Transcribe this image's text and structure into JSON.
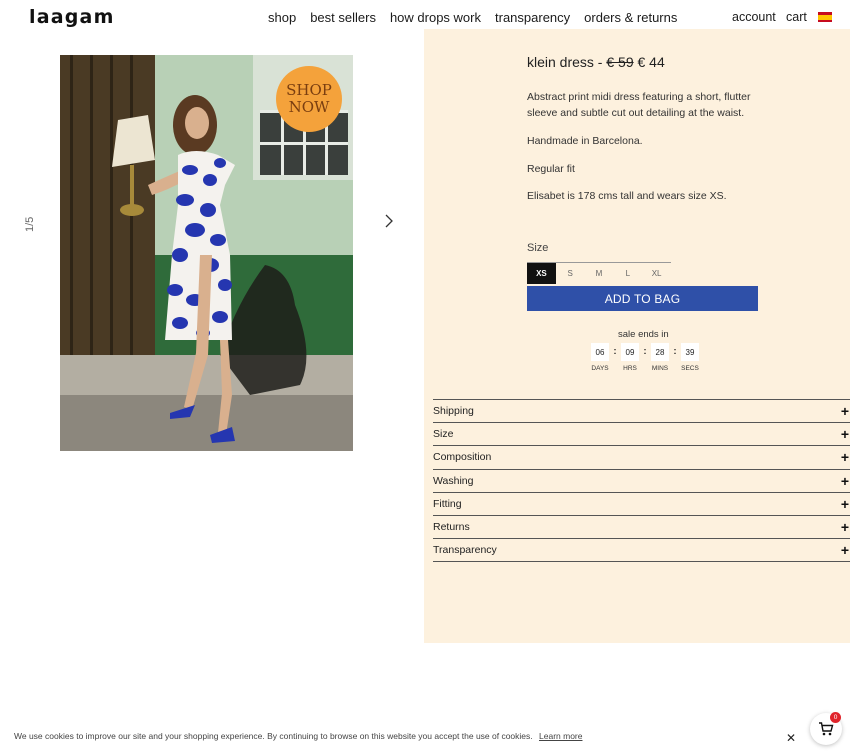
{
  "header": {
    "logo": "laagam",
    "nav": [
      "shop",
      "best sellers",
      "how drops work",
      "transparency",
      "orders & returns"
    ],
    "account_label": "account",
    "cart_label": "cart",
    "flag_icon": "spain-flag-icon"
  },
  "gallery": {
    "index": "1/5",
    "badge_line1": "SHOP",
    "badge_line2": "NOW",
    "badge_color": "#f4a23b"
  },
  "product": {
    "name": "klein dress -",
    "old_price": "€ 59",
    "price": "€ 44",
    "description": "Abstract print midi dress featuring a short, flutter sleeve and subtle cut out detailing at the waist.",
    "handmade": "Handmade in Barcelona.",
    "fit": "Regular fit",
    "model_info": "Elisabet is 178 cms tall and wears size XS.",
    "size_label": "Size",
    "sizes": [
      "XS",
      "S",
      "M",
      "L",
      "XL"
    ],
    "selected_size": "XS",
    "add_button": "ADD TO BAG",
    "accent_color": "#2f50a8",
    "panel_color": "#fdf1de"
  },
  "sale": {
    "label": "sale ends in",
    "countdown": [
      {
        "value": "06",
        "unit": "DAYS"
      },
      {
        "value": "09",
        "unit": "HRS"
      },
      {
        "value": "28",
        "unit": "MINS"
      },
      {
        "value": "39",
        "unit": "SECS"
      }
    ]
  },
  "accordion": [
    "Shipping",
    "Size",
    "Composition",
    "Washing",
    "Fitting",
    "Returns",
    "Transparency"
  ],
  "cookie": {
    "text": "We use cookies to improve our site and your shopping experience. By continuing to browse on this website you accept the use of cookies.",
    "link": "Learn more"
  },
  "cart_widget": {
    "count": "0"
  }
}
